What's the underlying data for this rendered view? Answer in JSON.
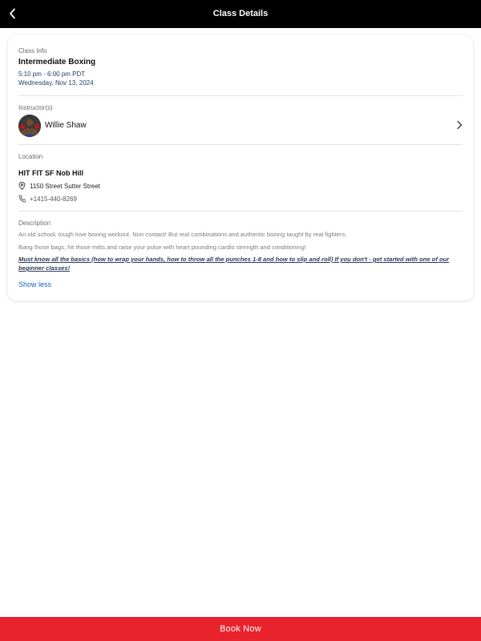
{
  "header": {
    "title": "Class Details",
    "back_icon": "chevron-left-icon"
  },
  "class_info": {
    "label": "Class Info",
    "name": "Intermediate Boxing",
    "time": "5:10 pm - 6:00 pm PDT",
    "date": "Wednesday, Nov 13, 2024"
  },
  "instructor": {
    "label": "Instructor(s)",
    "name": "Willie Shaw",
    "chevron_icon": "chevron-right-icon"
  },
  "location": {
    "label": "Location",
    "name": "HIT FIT SF Nob Hill",
    "address": "1150 Street Sutter Street",
    "phone": "+1415-440-8269",
    "address_icon": "map-pin-icon",
    "phone_icon": "phone-icon"
  },
  "description": {
    "label": "Description",
    "paragraph_1": "An old school, tough love boxing workout. Non contact! But real combinations and authentic boxing taught by real fighters.",
    "paragraph_2": "Bang those bags, hit those mitts and raise your pulse with heart pounding cardio strength and conditioning!",
    "paragraph_3": "Must know all the basics (how to wrap your hands, how to throw all the punches 1-8 and how to slip and roll) If you don't - get started with one of our beginner classes!",
    "toggle_label": "Show less"
  },
  "footer": {
    "book_label": "Book Now"
  },
  "colors": {
    "accent": "#e9232e",
    "link": "#1565c0",
    "header_bg": "#000000"
  }
}
